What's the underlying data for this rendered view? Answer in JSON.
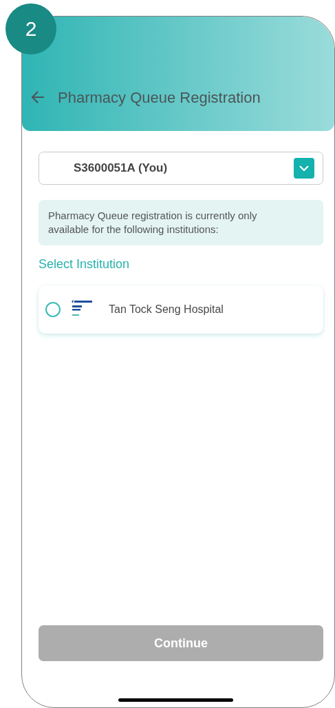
{
  "step_badge": "2",
  "header": {
    "title": "Pharmacy Queue Registration"
  },
  "patient_select": {
    "value": "S3600051A (You)"
  },
  "notice": "Pharmacy Queue registration is currently only available for the following institutions:",
  "section_label": "Select Institution",
  "institutions": [
    {
      "name": "Tan Tock Seng Hospital",
      "selected": false
    }
  ],
  "continue_button": {
    "label": "Continue",
    "disabled": true
  }
}
